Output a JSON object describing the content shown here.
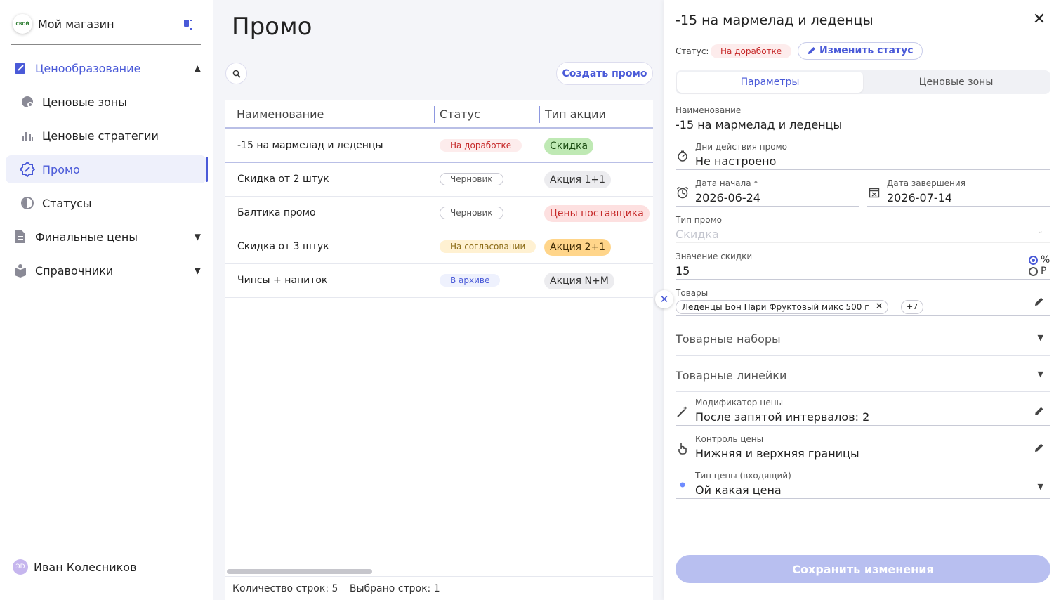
{
  "sidebar": {
    "brand_name": "Мой магазин",
    "logo_text": "СВОЙ",
    "items": [
      {
        "label": "Ценообразование"
      },
      {
        "label": "Ценовые зоны"
      },
      {
        "label": "Ценовые стратегии"
      },
      {
        "label": "Промо"
      },
      {
        "label": "Статусы"
      },
      {
        "label": "Финальные цены"
      },
      {
        "label": "Справочники"
      }
    ],
    "user": {
      "initials": "ЭD",
      "name": "Иван Колесников"
    }
  },
  "main": {
    "title": "Промо",
    "create_button": "Создать промо",
    "columns": [
      "Наименование",
      "Статус",
      "Тип акции"
    ],
    "rows": [
      {
        "name": "-15 на мармелад и леденцы",
        "status": "На доработке",
        "type": "Скидка"
      },
      {
        "name": "Скидка от 2 штук",
        "status": "Черновик",
        "type": "Акция 1+1"
      },
      {
        "name": "Балтика промо",
        "status": "Черновик",
        "type": "Цены поставщика"
      },
      {
        "name": "Скидка от 3 штук",
        "status": "На согласовании",
        "type": "Акция 2+1"
      },
      {
        "name": "Чипсы + напиток",
        "status": "В архиве",
        "type": "Акция N+M"
      }
    ],
    "footer": {
      "rows_count": "Количество строк: 5",
      "selected_count": "Выбрано строк: 1"
    }
  },
  "drawer": {
    "title": "-15 на мармелад и леденцы",
    "status_label": "Статус:",
    "status_value": "На доработке",
    "change_status": "Изменить статус",
    "tabs": [
      "Параметры",
      "Ценовые зоны"
    ],
    "fields": {
      "name": {
        "label": "Наименование",
        "value": "-15 на мармелад и леденцы"
      },
      "days": {
        "label": "Дни действия промо",
        "value": "Не настроено"
      },
      "start": {
        "label": "Дата начала *",
        "value": "2026-06-24"
      },
      "end": {
        "label": "Дата завершения",
        "value": "2026-07-14"
      },
      "promo_type": {
        "label": "Тип промо",
        "value": "Скидка"
      },
      "discount": {
        "label": "Значение скидки",
        "value": "15",
        "unit_percent": "%",
        "unit_rub": "Р"
      },
      "goods": {
        "label": "Товары",
        "chip": "Леденцы Бон Пари Фруктовый микс 500 г",
        "more": "+7"
      },
      "sets": {
        "label": "Товарные наборы"
      },
      "lines": {
        "label": "Товарные линейки"
      },
      "modifier": {
        "label": "Модификатор цены",
        "value": "После запятой интервалов: 2"
      },
      "control": {
        "label": "Контроль цены",
        "value": "Нижняя и верхняя границы"
      },
      "price_type": {
        "label": "Тип цены (входящий)",
        "value": "Ой какая цена"
      }
    },
    "save_button": "Сохранить изменения"
  },
  "colors": {
    "accent": "#4a5ad8",
    "danger": "#c62828",
    "disabled_button": "#b8bff0"
  }
}
